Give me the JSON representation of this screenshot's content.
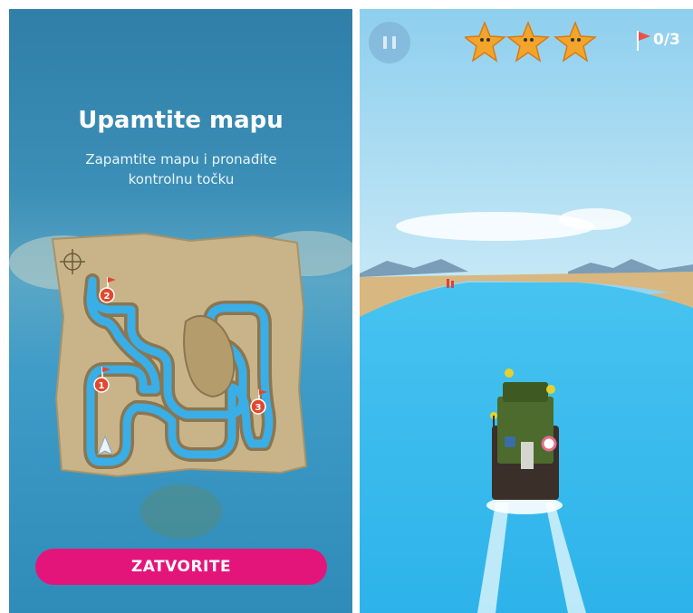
{
  "left_screen": {
    "title": "Upamtite mapu",
    "subtitle": "Zapamtite mapu i pronađite kontrolnu točku",
    "checkpoints": [
      "1",
      "2",
      "3"
    ],
    "close_button": "ZATVORITE",
    "colors": {
      "button": "#e4157a",
      "water": "#3aaee6",
      "map_paper": "#c9b48a",
      "marker": "#e2482e"
    }
  },
  "right_screen": {
    "stars_count": 3,
    "checkpoints_found": "0/3",
    "icons": [
      "pause-icon",
      "starfish-star-icon",
      "red-flag-icon"
    ],
    "colors": {
      "sea": "#3fbff0",
      "sky": "#9ad3ee",
      "boat": "#4d6b2c"
    }
  }
}
